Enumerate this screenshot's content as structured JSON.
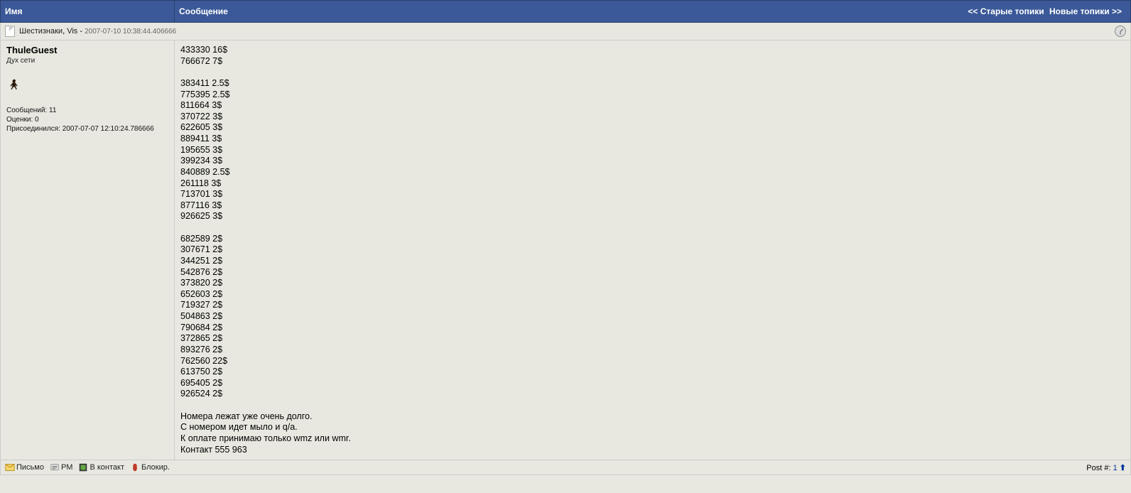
{
  "header": {
    "col_name": "Имя",
    "col_msg": "Сообщение",
    "older": "<< Старые топики",
    "newer": "Новые топики >>"
  },
  "topic": {
    "title": "Шестизнаки",
    "author": "Vis",
    "date": "2007-07-10 10:38:44.406666"
  },
  "user": {
    "name": "ThuleGuest",
    "title": "Дух сети",
    "posts_label": "Сообщений:",
    "posts": "11",
    "ratings_label": "Оценки:",
    "ratings": "0",
    "joined_label": "Присоединился:",
    "joined": "2007-07-07 12:10:24.786666"
  },
  "message": {
    "body": "433330 16$\n766672 7$\n\n383411 2.5$\n775395 2.5$\n811664 3$\n370722 3$\n622605 3$\n889411 3$\n195655 3$\n399234 3$\n840889 2.5$\n261118 3$\n713701 3$\n877116 3$\n926625 3$\n\n682589 2$\n307671 2$\n344251 2$\n542876 2$\n373820 2$\n652603 2$\n719327 2$\n504863 2$\n790684 2$\n372865 2$\n893276 2$\n762560 22$\n613750 2$\n695405 2$\n926524 2$\n\nНомера лежат уже очень долго.\nС номером идет мыло и q/a.\nК оплате принимаю только wmz или wmr.\nКонтакт 555 963"
  },
  "actions": {
    "mail": "Письмо",
    "pm": "PM",
    "contact": "В контакт",
    "block": "Блокир."
  },
  "footer": {
    "post_label": "Post #:",
    "post_num": "1"
  }
}
